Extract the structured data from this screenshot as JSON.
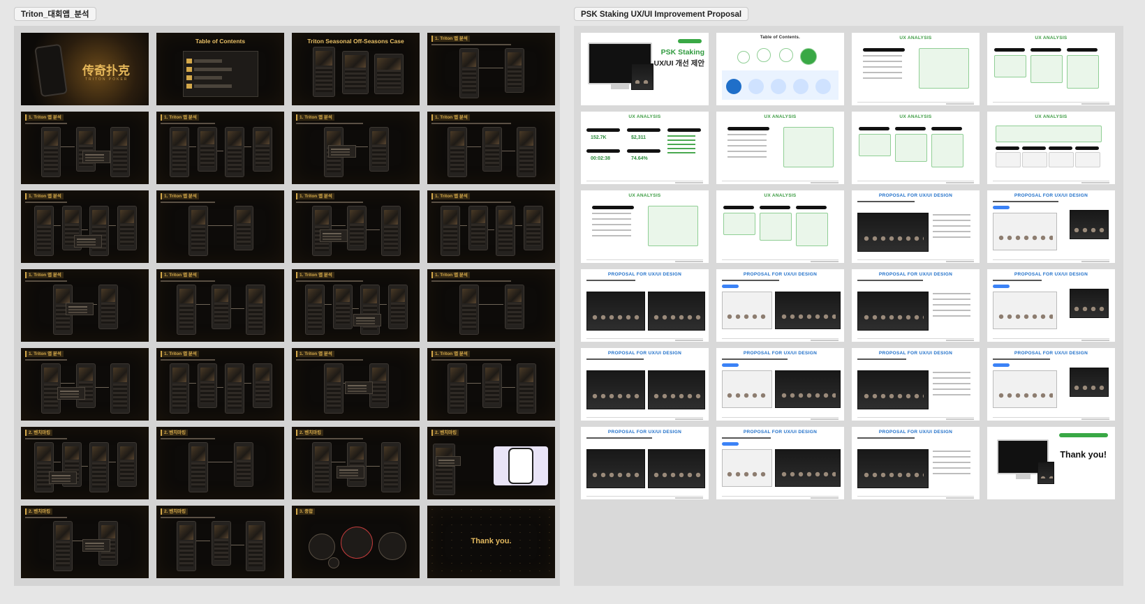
{
  "groups": {
    "triton": {
      "label": "Triton_대회앱_분석"
    },
    "psk": {
      "label": "PSK Staking UX/UI Improvement Proposal"
    }
  },
  "triton_slides": [
    {
      "title": "",
      "variant": "cover",
      "logo": "传奇扑克",
      "sub": "TRITON POKER"
    },
    {
      "title": "Table of Contents",
      "variant": "toc"
    },
    {
      "title": "Triton Seasonal Off-Seasons Case",
      "variant": "centered"
    },
    {
      "title": "1. Triton 앱 분석",
      "variant": "phones"
    },
    {
      "title": "1. Triton 앱 분석",
      "variant": "phones"
    },
    {
      "title": "1. Triton 앱 분석",
      "variant": "phones"
    },
    {
      "title": "1. Triton 앱 분석",
      "variant": "phones"
    },
    {
      "title": "1. Triton 앱 분석",
      "variant": "phones"
    },
    {
      "title": "1. Triton 앱 분석",
      "variant": "phones"
    },
    {
      "title": "1. Triton 앱 분석",
      "variant": "phones"
    },
    {
      "title": "1. Triton 앱 분석",
      "variant": "phones"
    },
    {
      "title": "1. Triton 앱 분석",
      "variant": "phones"
    },
    {
      "title": "1. Triton 앱 분석",
      "variant": "phones"
    },
    {
      "title": "1. Triton 앱 분석",
      "variant": "phones"
    },
    {
      "title": "1. Triton 앱 분석",
      "variant": "phones"
    },
    {
      "title": "1. Triton 앱 분석",
      "variant": "phones"
    },
    {
      "title": "1. Triton 앱 분석",
      "variant": "phones"
    },
    {
      "title": "1. Triton 앱 분석",
      "variant": "phones"
    },
    {
      "title": "1. Triton 앱 분석",
      "variant": "phones"
    },
    {
      "title": "1. Triton 앱 분석",
      "variant": "phones"
    },
    {
      "title": "2. 벤치마킹",
      "variant": "phones"
    },
    {
      "title": "2. 벤치마킹",
      "variant": "phones"
    },
    {
      "title": "2. 벤치마킹",
      "variant": "phones"
    },
    {
      "title": "2. 벤치마킹",
      "variant": "tablet"
    },
    {
      "title": "2. 벤치마킹",
      "variant": "phones"
    },
    {
      "title": "2. 벤치마킹",
      "variant": "phones"
    },
    {
      "title": "3. 종합",
      "variant": "nodes"
    },
    {
      "title": "",
      "variant": "thanks",
      "text": "Thank you."
    }
  ],
  "psk_slides": [
    {
      "title": "",
      "variant": "cover",
      "line1": "PSK Staking",
      "line2": "UX/UI 개선 제안"
    },
    {
      "title": "Table of Contents.",
      "variant": "toc"
    },
    {
      "title": "UX ANALYSIS",
      "variant": "ux"
    },
    {
      "title": "UX ANALYSIS",
      "variant": "ux"
    },
    {
      "title": "UX ANALYSIS",
      "variant": "stats",
      "stat1": "152.7K",
      "stat2": "$2,311",
      "stat3": "00:02:38",
      "stat4": "74.64%"
    },
    {
      "title": "UX ANALYSIS",
      "variant": "ux"
    },
    {
      "title": "UX ANALYSIS",
      "variant": "ux"
    },
    {
      "title": "UX ANALYSIS",
      "variant": "ux"
    },
    {
      "title": "UX ANALYSIS",
      "variant": "ux"
    },
    {
      "title": "UX ANALYSIS",
      "variant": "ux"
    },
    {
      "title": "PROPOSAL FOR UX/UI DESIGN",
      "variant": "prop"
    },
    {
      "title": "PROPOSAL FOR UX/UI DESIGN",
      "variant": "prop"
    },
    {
      "title": "PROPOSAL FOR UX/UI DESIGN",
      "variant": "prop"
    },
    {
      "title": "PROPOSAL FOR UX/UI DESIGN",
      "variant": "prop"
    },
    {
      "title": "PROPOSAL FOR UX/UI DESIGN",
      "variant": "prop"
    },
    {
      "title": "PROPOSAL FOR UX/UI DESIGN",
      "variant": "prop"
    },
    {
      "title": "PROPOSAL FOR UX/UI DESIGN",
      "variant": "prop"
    },
    {
      "title": "PROPOSAL FOR UX/UI DESIGN",
      "variant": "prop"
    },
    {
      "title": "PROPOSAL FOR UX/UI DESIGN",
      "variant": "prop"
    },
    {
      "title": "PROPOSAL FOR UX/UI DESIGN",
      "variant": "prop"
    },
    {
      "title": "PROPOSAL FOR UX/UI DESIGN",
      "variant": "prop"
    },
    {
      "title": "PROPOSAL FOR UX/UI DESIGN",
      "variant": "prop"
    },
    {
      "title": "PROPOSAL FOR UX/UI DESIGN",
      "variant": "prop"
    },
    {
      "title": "",
      "variant": "thanks",
      "text": "Thank you!"
    }
  ],
  "colors": {
    "triton_gold": "#d4a84a",
    "psk_green": "#39a845",
    "psk_blue": "#1f6fc9"
  }
}
